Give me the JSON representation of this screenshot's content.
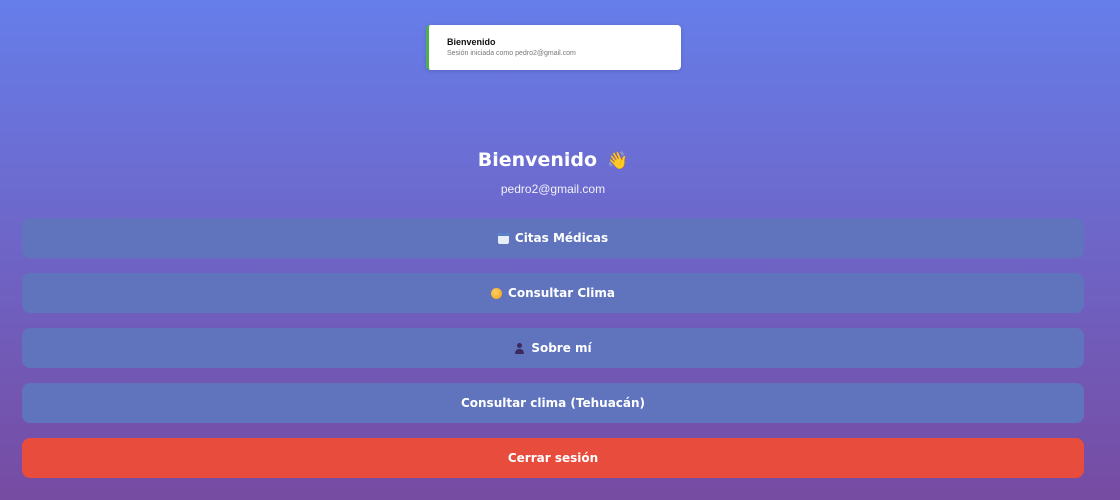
{
  "toast": {
    "title": "Bienvenido",
    "message": "Sesión iniciada como pedro2@gmail.com",
    "accent_color": "#4caf50"
  },
  "header": {
    "welcome": "Bienvenido",
    "wave_emoji": "👋",
    "email": "pedro2@gmail.com"
  },
  "menu": {
    "items": [
      {
        "label": "Citas Médicas",
        "icon": "calendar-icon"
      },
      {
        "label": "Consultar Clima",
        "icon": "sun-icon"
      },
      {
        "label": "Sobre mí",
        "icon": "person-icon"
      },
      {
        "label": "Consultar clima (Tehuacán)",
        "icon": ""
      }
    ],
    "logout_label": "Cerrar sesión"
  },
  "colors": {
    "background_top": "#667eea",
    "background_bottom": "#764ba2",
    "menu_button": "#5f74bd",
    "logout_button": "#e74c3c"
  }
}
